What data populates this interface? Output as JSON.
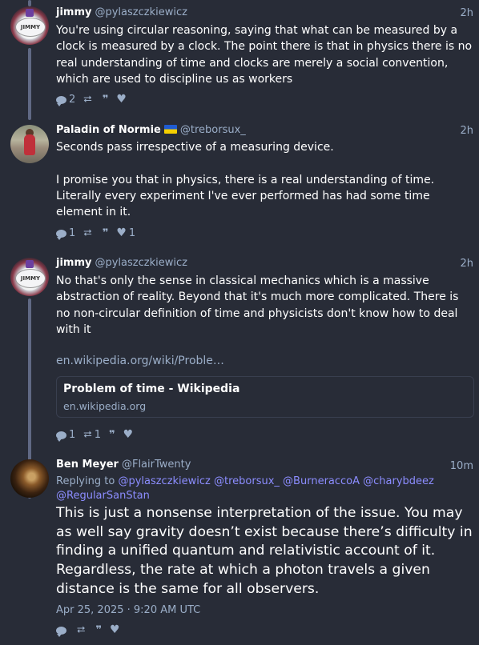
{
  "posts": [
    {
      "name": "jimmy",
      "handle": "@pylaszczkiewicz",
      "time": "2h",
      "text": "You're using circular reasoning, saying that what can be measured by a clock is measured by a clock. The point there is that in physics there is no real understanding of time and clocks are merely a social convention, which are used to discipline us as workers",
      "replies": "2",
      "boosts": "",
      "favs": ""
    },
    {
      "name": "Paladin of Normie",
      "handle": "@treborsux_",
      "time": "2h",
      "text": "Seconds pass irrespective of a measuring device.\n\nI promise you that in physics, there is a real understanding of time. Literally every experiment I've ever performed has had some time element in it.",
      "replies": "1",
      "boosts": "",
      "favs": "1"
    },
    {
      "name": "jimmy",
      "handle": "@pylaszczkiewicz",
      "time": "2h",
      "text": "No that's only the sense in classical mechanics which is a massive abstraction of reality. Beyond that it's much more complicated. There is no non-circular definition of time and physicists don't know how to deal with it",
      "link": "en.wikipedia.org/wiki/Proble…",
      "card": {
        "title": "Problem of time - Wikipedia",
        "url": "en.wikipedia.org"
      },
      "replies": "1",
      "boosts": "1",
      "favs": ""
    },
    {
      "name": "Ben Meyer",
      "handle": "@FlairTwenty",
      "time": "10m",
      "replying_prefix": "Replying to",
      "mentions": "@pylaszczkiewicz @treborsux_ @BurneraccoA @charybdeez @RegularSanStan",
      "text": "This is just a nonsense interpretation of the issue. You may as well say gravity doesn’t exist because there’s difficulty in finding a unified quantum and relativistic account of it. Regardless, the rate at which a photon travels a given distance is the same for all observers.",
      "date": "Apr 25, 2025 · 9:20 AM UTC",
      "replies": "",
      "boosts": "",
      "favs": ""
    }
  ],
  "icons": {
    "reply": "reply-bubble-icon",
    "boost": "boost-arrows-icon",
    "quote": "quote-icon",
    "fav": "heart-icon"
  },
  "colors": {
    "background": "#282c37",
    "muted": "#9baec8",
    "thread_line": "#606984",
    "text": "#ffffff"
  }
}
